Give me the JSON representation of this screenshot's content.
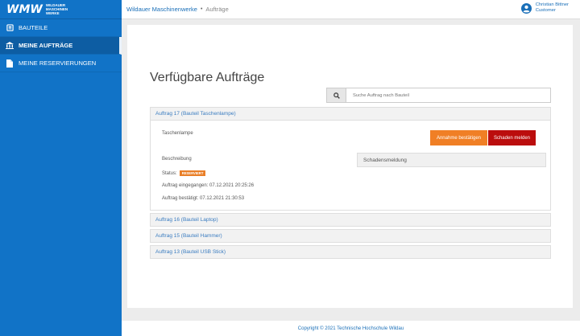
{
  "logo": {
    "main": "WMW",
    "sub_lines": [
      "WILDAUER",
      "MASCHINEN",
      "WERKE"
    ]
  },
  "sidebar": {
    "items": [
      {
        "label": "BAUTEILE",
        "icon": "parts-icon",
        "active": false
      },
      {
        "label": "MEINE AUFTRÄGE",
        "icon": "bank-icon",
        "active": true
      },
      {
        "label": "MEINE RESERVIERUNGEN",
        "icon": "document-icon",
        "active": false
      }
    ]
  },
  "breadcrumb": {
    "main": "Wildauer Maschinenwerke",
    "separator": "•",
    "current": "Aufträge"
  },
  "user": {
    "name": "Christian Bittner",
    "role": "Customer",
    "icon": "user-circle-icon"
  },
  "page": {
    "title": "Verfügbare Aufträge",
    "search": {
      "placeholder": "Suche Auftrag nach Bauteil",
      "value": "",
      "icon": "search-icon"
    }
  },
  "orders": {
    "expanded": {
      "header": "Auftrag 17 (Bauteil Taschenlampe)",
      "part_name": "Taschenlampe",
      "accept_label": "Annahme bestätigen",
      "damage_label": "Schaden melden",
      "description_label": "Beschreibung",
      "status_label": "Status:",
      "status_value": "RESERVIERT",
      "received": "Auftrag eingegangen: 07.12.2021 20:25:26",
      "confirmed": "Auftrag bestätigt: 07.12.2021 21:30:53",
      "damage_report_label": "Schadensmeldung"
    },
    "collapsed": [
      {
        "header": "Auftrag 16 (Bauteil Laptop)"
      },
      {
        "header": "Auftrag 15 (Bauteil Hammer)"
      },
      {
        "header": "Auftrag 13 (Bauteil USB Stick)"
      }
    ]
  },
  "footer": {
    "text": "Copyright © 2021 Technische Hochschule Wildau"
  },
  "colors": {
    "primary": "#1173c7",
    "accent": "#f07f25",
    "danger": "#bb0d0d"
  }
}
